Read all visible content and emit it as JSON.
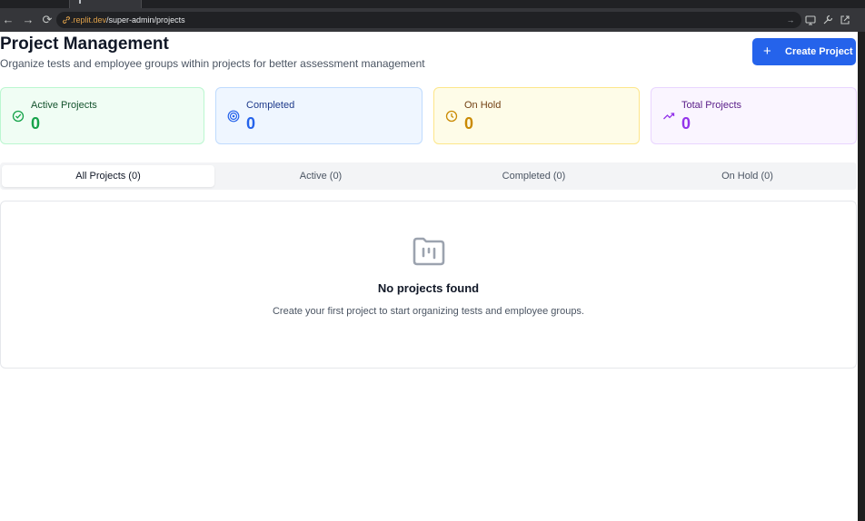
{
  "browser": {
    "url_host": ".replit.dev",
    "url_path": "/super-admin/projects"
  },
  "header": {
    "title": "Project Management",
    "subtitle": "Organize tests and employee groups within projects for better assessment management",
    "create_button_label": "Create Project"
  },
  "stats": [
    {
      "label": "Active Projects",
      "value": "0",
      "icon": "circle-check-icon",
      "color": "#16a34a"
    },
    {
      "label": "Completed",
      "value": "0",
      "icon": "target-icon",
      "color": "#2563eb"
    },
    {
      "label": "On Hold",
      "value": "0",
      "icon": "clock-icon",
      "color": "#ca8a04"
    },
    {
      "label": "Total Projects",
      "value": "0",
      "icon": "trending-up-icon",
      "color": "#9333ea"
    }
  ],
  "tabs": [
    {
      "label": "All Projects (0)",
      "active": true
    },
    {
      "label": "Active (0)",
      "active": false
    },
    {
      "label": "Completed (0)",
      "active": false
    },
    {
      "label": "On Hold (0)",
      "active": false
    }
  ],
  "empty_state": {
    "icon": "folder-kanban-icon",
    "title": "No projects found",
    "description": "Create your first project to start organizing tests and employee groups."
  },
  "colors": {
    "primary": "#2563eb"
  }
}
